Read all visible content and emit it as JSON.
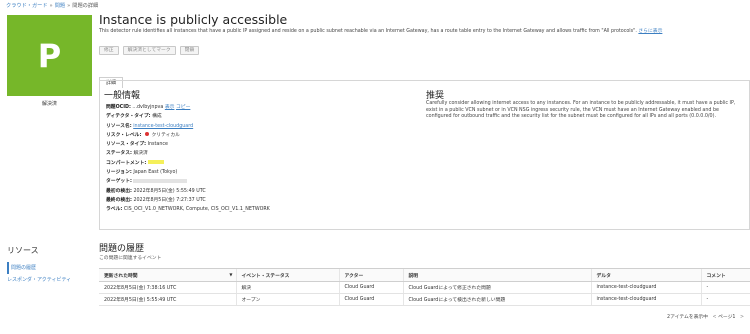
{
  "breadcrumb": [
    "クラウド・ガード",
    "問題",
    "問題の詳細"
  ],
  "tile": {
    "letter": "P",
    "status": "解決済",
    "color": "#76b729"
  },
  "header": {
    "title": "Instance is publicly accessible",
    "description": "This detector rule identifies all instances that have a public IP assigned and reside on a public subnet reachable via an Internet Gateway, has a route table entry to the Internet Gateway and allows traffic from \"All protocols\".",
    "description_link": "さらに表示"
  },
  "actions": {
    "btn1": "修正",
    "btn2": "解決済としてマーク",
    "btn3": "閉鎖"
  },
  "tabs": {
    "details": "詳細"
  },
  "general": {
    "title": "一般情報",
    "ocid_label": "問題OCID:",
    "ocid_value": "...dvlbyjnpva",
    "ocid_show": "表示",
    "ocid_copy": "コピー",
    "detector_label": "ディテクタ・タイプ:",
    "detector_value": "構成",
    "resource_label": "リソース名:",
    "resource_value": "instance-test-cloudguard",
    "risk_label": "リスク・レベル:",
    "risk_value": "クリティカル",
    "rtype_label": "リソース・タイプ:",
    "rtype_value": "Instance",
    "status_label": "ステータス:",
    "status_value": "解決済",
    "compartment_label": "コンパートメント:",
    "region_label": "リージョン:",
    "region_value": "Japan East (Tokyo)",
    "target_label": "ターゲット:",
    "first_label": "最初の検出:",
    "first_value": "2022年8月5日(金) 5:55:49 UTC",
    "last_label": "最終の検出:",
    "last_value": "2022年8月5日(金) 7:27:37 UTC",
    "labels_label": "ラベル:",
    "labels_value": "CIS_OCI_V1.0_NETWORK, Compute, CIS_OCI_V1.1_NETWORK"
  },
  "recommendation": {
    "title": "推奨",
    "text": "Carefully consider allowing internet access to any instances. For an instance to be publicly addressable, it must have a public IP, exist in a public VCN subnet or in VCN NSG ingress security rule, the VCN must have an Internet Gateway enabled and be configured for outbound traffic and the security list for the subnet must be configured for all IPs and all ports (0.0.0.0/0)."
  },
  "sidebar": {
    "title": "リソース",
    "items": [
      "問題の履歴",
      "レスポンダ・アクティビティ"
    ]
  },
  "history": {
    "title": "問題の履歴",
    "subtitle": "この問題に関連するイベント",
    "columns": [
      "更新された時間",
      "イベント・ステータス",
      "アクター",
      "説明",
      "デルタ",
      "コメント"
    ],
    "rows": [
      [
        "2022年8月5日(金) 7:38:16 UTC",
        "解決",
        "Cloud Guard",
        "Cloud Guardによって修正された問題",
        "instance-test-cloudguard",
        "-"
      ],
      [
        "2022年8月5日(金) 5:55:49 UTC",
        "オープン",
        "Cloud Guard",
        "Cloud Guardによって検出された新しい問題",
        "instance-test-cloudguard",
        "-"
      ]
    ],
    "pager": "2アイテムを表示中",
    "pager_prev": "<",
    "pager_page": "ページ1",
    "pager_next": ">"
  },
  "colors": {
    "accent": "#3c7fc2",
    "tile": "#76b729",
    "risk": "#dd3333",
    "highlight": "#f5f05a"
  }
}
